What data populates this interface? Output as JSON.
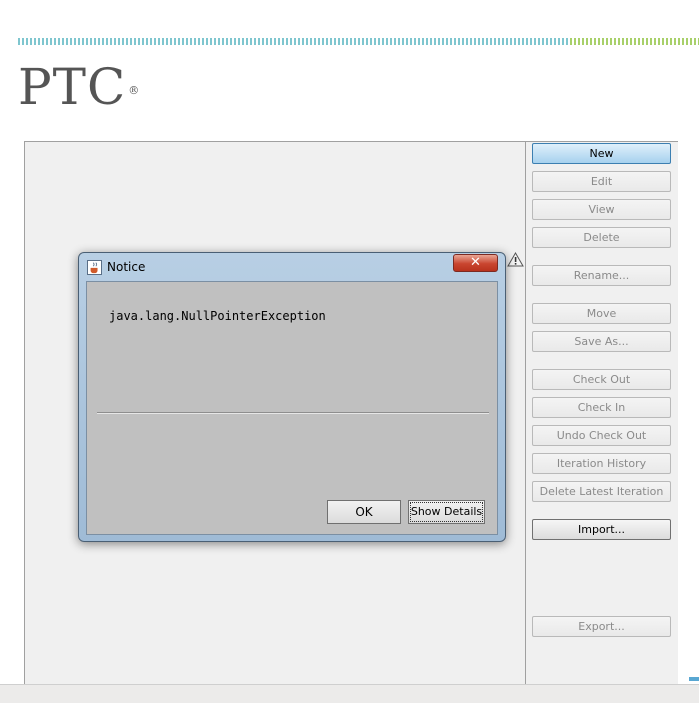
{
  "logo": {
    "text": "PTC",
    "mark": "®"
  },
  "colors": {
    "accent_stripe": "#7fc6cf",
    "accent_stripe_alt": "#a8d06a",
    "primary_button": "#a6d1ee",
    "dialog_frame": "#b8cfe4",
    "close_button": "#c9452f"
  },
  "side_buttons": {
    "new": "New",
    "edit": "Edit",
    "view": "View",
    "delete": "Delete",
    "rename": "Rename...",
    "move": "Move",
    "save_as": "Save As...",
    "check_out": "Check Out",
    "check_in": "Check In",
    "undo_check_out": "Undo Check Out",
    "iteration_history": "Iteration History",
    "delete_latest_iteration": "Delete Latest Iteration",
    "import": "Import...",
    "export": "Export..."
  },
  "dialog": {
    "title": "Notice",
    "close_glyph": "✕",
    "message": "java.lang.NullPointerException",
    "ok_label": "OK",
    "show_details_label": "Show Details"
  },
  "icons": {
    "warning": "warning-icon",
    "dialog": "java-cup-icon",
    "close": "close-icon"
  }
}
